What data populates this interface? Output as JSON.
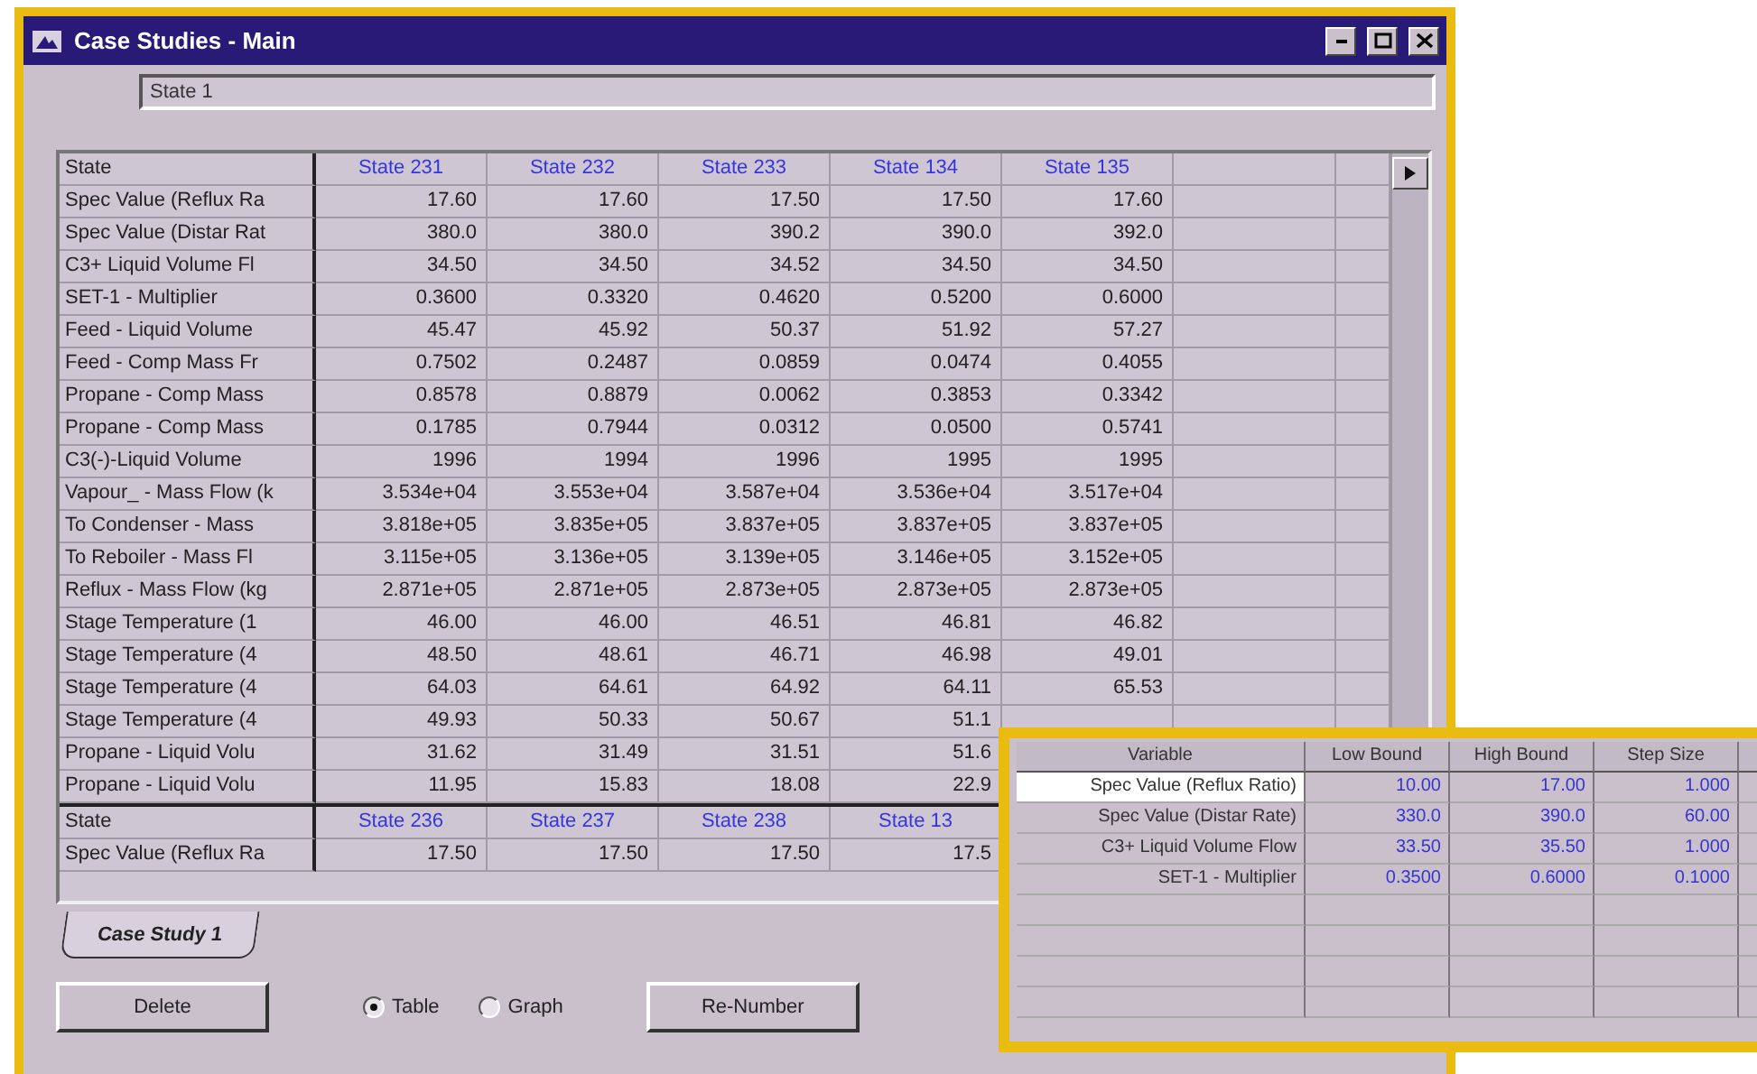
{
  "window": {
    "title": "Case Studies - Main"
  },
  "state_field": {
    "value": "State 1"
  },
  "grid": {
    "blocks": [
      {
        "header_label": "State",
        "columns": [
          "State 231",
          "State 232",
          "State 233",
          "State 134",
          "State 135"
        ],
        "rows": [
          {
            "label": "Spec Value (Reflux Ra",
            "values": [
              "17.60",
              "17.60",
              "17.50",
              "17.50",
              "17.60"
            ]
          },
          {
            "label": "Spec Value (Distar Rat",
            "values": [
              "380.0",
              "380.0",
              "390.2",
              "390.0",
              "392.0"
            ]
          },
          {
            "label": "C3+ Liquid Volume Fl",
            "values": [
              "34.50",
              "34.50",
              "34.52",
              "34.50",
              "34.50"
            ]
          },
          {
            "label": "SET-1 - Multiplier",
            "values": [
              "0.3600",
              "0.3320",
              "0.4620",
              "0.5200",
              "0.6000"
            ]
          },
          {
            "label": "Feed - Liquid Volume",
            "values": [
              "45.47",
              "45.92",
              "50.37",
              "51.92",
              "57.27"
            ]
          },
          {
            "label": "Feed - Comp Mass Fr",
            "values": [
              "0.7502",
              "0.2487",
              "0.0859",
              "0.0474",
              "0.4055"
            ]
          },
          {
            "label": "Propane - Comp Mass",
            "values": [
              "0.8578",
              "0.8879",
              "0.0062",
              "0.3853",
              "0.3342"
            ]
          },
          {
            "label": "Propane - Comp Mass",
            "values": [
              "0.1785",
              "0.7944",
              "0.0312",
              "0.0500",
              "0.5741"
            ]
          },
          {
            "label": "C3(-)-Liquid Volume",
            "values": [
              "1996",
              "1994",
              "1996",
              "1995",
              "1995"
            ]
          },
          {
            "label": "Vapour_ - Mass Flow (k",
            "values": [
              "3.534e+04",
              "3.553e+04",
              "3.587e+04",
              "3.536e+04",
              "3.517e+04"
            ]
          },
          {
            "label": "To Condenser - Mass",
            "values": [
              "3.818e+05",
              "3.835e+05",
              "3.837e+05",
              "3.837e+05",
              "3.837e+05"
            ]
          },
          {
            "label": "To Reboiler - Mass Fl",
            "values": [
              "3.115e+05",
              "3.136e+05",
              "3.139e+05",
              "3.146e+05",
              "3.152e+05"
            ]
          },
          {
            "label": "Reflux - Mass Flow (kg",
            "values": [
              "2.871e+05",
              "2.871e+05",
              "2.873e+05",
              "2.873e+05",
              "2.873e+05"
            ]
          },
          {
            "label": "Stage Temperature (1",
            "values": [
              "46.00",
              "46.00",
              "46.51",
              "46.81",
              "46.82"
            ]
          },
          {
            "label": "Stage Temperature (4",
            "values": [
              "48.50",
              "48.61",
              "46.71",
              "46.98",
              "49.01"
            ]
          },
          {
            "label": "Stage Temperature (4",
            "values": [
              "64.03",
              "64.61",
              "64.92",
              "64.11",
              "65.53"
            ]
          },
          {
            "label": "Stage Temperature (4",
            "values": [
              "49.93",
              "50.33",
              "50.67",
              "51.1"
            ]
          },
          {
            "label": "Propane - Liquid Volu",
            "values": [
              "31.62",
              "31.49",
              "31.51",
              "51.6"
            ]
          },
          {
            "label": "Propane - Liquid Volu",
            "values": [
              "11.95",
              "15.83",
              "18.08",
              "22.9"
            ]
          }
        ]
      },
      {
        "header_label": "State",
        "columns": [
          "State 236",
          "State 237",
          "State 238",
          "State 13"
        ],
        "rows": [
          {
            "label": "Spec Value (Reflux Ra",
            "values": [
              "17.50",
              "17.50",
              "17.50",
              "17.5"
            ]
          }
        ]
      }
    ]
  },
  "tabs": [
    {
      "label": "Case Study 1",
      "selected": true
    }
  ],
  "buttons": [
    {
      "label": "Delete"
    },
    {
      "label": "Re-Number"
    }
  ],
  "view_options": [
    {
      "label": "Table",
      "selected": true
    },
    {
      "label": "Graph",
      "selected": false
    }
  ],
  "variables_window": {
    "columns": [
      "Variable",
      "Low Bound",
      "High Bound",
      "Step Size"
    ],
    "rows": [
      {
        "name": "Spec Value (Reflux Ratio)",
        "selected": true,
        "values": [
          "10.00",
          "17.00",
          "1.000"
        ]
      },
      {
        "name": "Spec Value (Distar Rate)",
        "selected": false,
        "values": [
          "330.0",
          "390.0",
          "60.00"
        ]
      },
      {
        "name": "C3+ Liquid Volume Flow",
        "selected": false,
        "values": [
          "33.50",
          "35.50",
          "1.000"
        ]
      },
      {
        "name": "SET-1 - Multiplier",
        "selected": false,
        "values": [
          "0.3500",
          "0.6000",
          "0.1000"
        ]
      }
    ]
  }
}
